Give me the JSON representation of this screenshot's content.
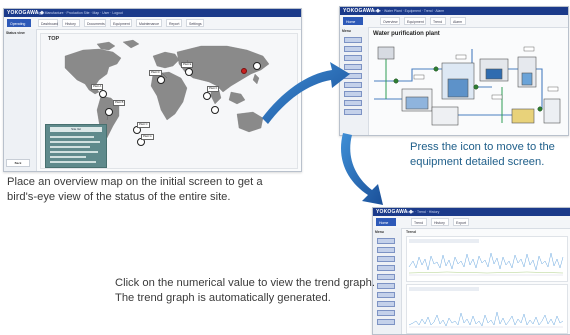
{
  "overview": {
    "nav_logo": "YOKOGAWA ◆",
    "nav_links": "Sight Manufacture  ·  Production Site  ·  Map  ·  User  ·  Logout",
    "toolbar_buttons": [
      "Operating",
      "Dashboard",
      "History",
      "Documents",
      "Equipment",
      "Maintenance",
      "Report",
      "Settings"
    ],
    "side_head": "Status view",
    "side_button": "Back",
    "map_title": "TOP",
    "legend_head": "Site list",
    "marker_labels": [
      "Plant A",
      "Plant B",
      "Plant C",
      "Plant D",
      "Plant E",
      "Plant F",
      "Plant G"
    ]
  },
  "plant": {
    "nav_logo": "YOKOGAWA ◆",
    "nav_links": "Home  ·  Water Plant  ·  Equipment  ·  Trend  ·  Alarm",
    "toolbar_buttons": [
      "Home",
      "Overview",
      "Equipment",
      "Trend",
      "Alarm"
    ],
    "side_head": "Menu",
    "title": "Water purification plant"
  },
  "trend": {
    "nav_logo": "YOKOGAWA ◆",
    "nav_links": "Home  ·  Trend  ·  History",
    "toolbar_buttons": [
      "Home",
      "Trend",
      "History",
      "Export"
    ],
    "side_head": "Menu",
    "title": "Trend"
  },
  "captions": {
    "overview": "Place an overview map on the initial screen to get a bird's-eye view of the status of the entire site.",
    "plant": "Press the icon to move to the equipment detailed screen.",
    "trend": "Click on the numerical value to view the trend graph. The trend graph is automatically generated."
  },
  "colors": {
    "navbar": "#1b3a8a",
    "arrow": "#1e5fa8",
    "plant_caption": "#1f5f8a",
    "caption": "#3b3b3b"
  }
}
